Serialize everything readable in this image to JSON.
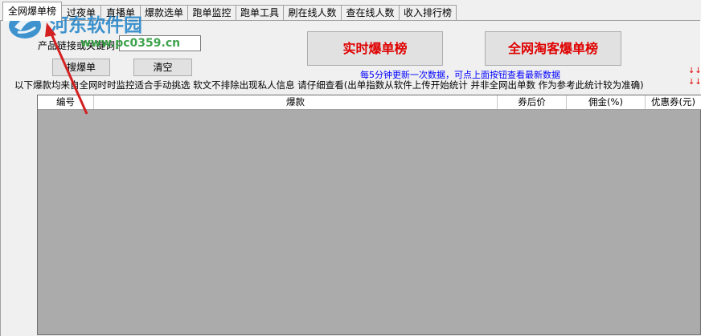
{
  "tabs": [
    {
      "label": "全网爆单榜",
      "active": true
    },
    {
      "label": "过夜单"
    },
    {
      "label": "直播单"
    },
    {
      "label": "爆款选单"
    },
    {
      "label": "跑单监控"
    },
    {
      "label": "跑单工具"
    },
    {
      "label": "刷在线人数"
    },
    {
      "label": "查在线人数"
    },
    {
      "label": "收入排行榜"
    }
  ],
  "search": {
    "label": "产品链接或关键词:",
    "value": ""
  },
  "buttons": {
    "search": "搜爆单",
    "clear": "清空",
    "realtime": "实时爆单榜",
    "taoke": "全网淘客爆单榜"
  },
  "notice": "每5分钟更新一次数据，可点上面按钮查看最新数据",
  "arrows": "↓↓",
  "info": "以下爆款均来自全网时时监控适合手动挑选  软文不排除出现私人信息  请仔细查看(出单指数从软件上传开始统计  并非全网出单数  作为参考此统计较为准确)",
  "table": {
    "columns": [
      "编号",
      "爆款",
      "券后价",
      "佣金(%)",
      "优惠券(元)"
    ]
  },
  "watermark": {
    "text": "河东软件园",
    "url": "www.pc0359.cn"
  },
  "colors": {
    "accent_red": "#e00000",
    "notice_blue": "#0000ff",
    "grid_bg": "#ababab"
  }
}
